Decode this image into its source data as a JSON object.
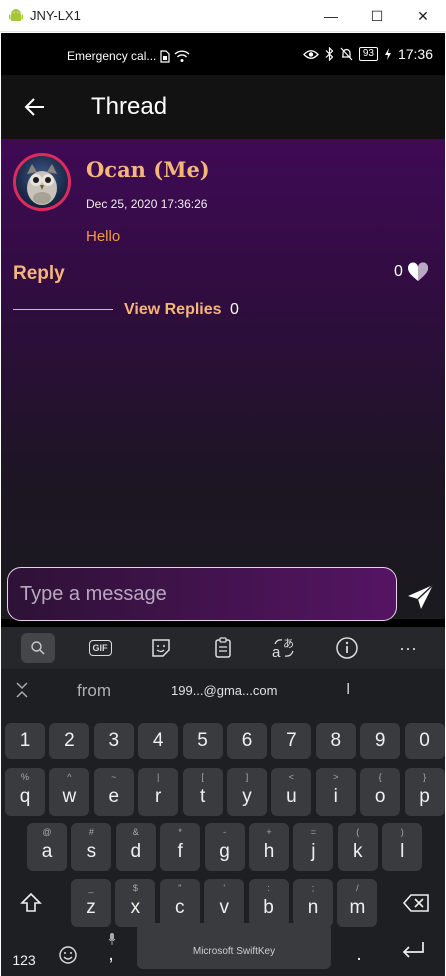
{
  "window": {
    "title": "JNY-LX1",
    "minimize_glyph": "—",
    "maximize_glyph": "☐",
    "close_glyph": "✕"
  },
  "status_bar": {
    "carrier": "Emergency cal...",
    "battery": "93",
    "time": "17:36",
    "icons": [
      "sim-icon",
      "wifi-icon",
      "eye-icon",
      "bluetooth-icon",
      "mute-icon",
      "battery-icon",
      "charging-icon"
    ]
  },
  "app_bar": {
    "title": "Thread",
    "back_icon": "arrow-left-icon"
  },
  "post": {
    "username": "Ocan (Me)",
    "timestamp": "Dec 25, 2020 17:36:26",
    "message": "Hello",
    "reply_label": "Reply",
    "like_count": "0",
    "view_replies_label": "View Replies",
    "replies_count": "0"
  },
  "composer": {
    "placeholder": "Type a message",
    "send_icon": "send-icon"
  },
  "keyboard": {
    "toolbar_icons": [
      "search-icon",
      "gif-icon",
      "sticker-icon",
      "clipboard-icon",
      "translate-icon",
      "info-icon",
      "more-icon"
    ],
    "gif_label": "GIF",
    "more_label": "···",
    "suggestions": [
      "from",
      "199...@gma...com",
      "I"
    ],
    "number_row": [
      "1",
      "2",
      "3",
      "4",
      "5",
      "6",
      "7",
      "8",
      "9",
      "0"
    ],
    "row1": [
      {
        "key": "q",
        "hint": "%"
      },
      {
        "key": "w",
        "hint": "^"
      },
      {
        "key": "e",
        "hint": "~"
      },
      {
        "key": "r",
        "hint": "|"
      },
      {
        "key": "t",
        "hint": "["
      },
      {
        "key": "y",
        "hint": "]"
      },
      {
        "key": "u",
        "hint": "<"
      },
      {
        "key": "i",
        "hint": ">"
      },
      {
        "key": "o",
        "hint": "{"
      },
      {
        "key": "p",
        "hint": "}"
      }
    ],
    "row2": [
      {
        "key": "a",
        "hint": "@"
      },
      {
        "key": "s",
        "hint": "#"
      },
      {
        "key": "d",
        "hint": "&"
      },
      {
        "key": "f",
        "hint": "*"
      },
      {
        "key": "g",
        "hint": "-"
      },
      {
        "key": "h",
        "hint": "+"
      },
      {
        "key": "j",
        "hint": "="
      },
      {
        "key": "k",
        "hint": "("
      },
      {
        "key": "l",
        "hint": ")"
      }
    ],
    "row3": [
      {
        "key": "z",
        "hint": "_"
      },
      {
        "key": "x",
        "hint": "$"
      },
      {
        "key": "c",
        "hint": "\""
      },
      {
        "key": "v",
        "hint": "'"
      },
      {
        "key": "b",
        "hint": ":"
      },
      {
        "key": "n",
        "hint": ";"
      },
      {
        "key": "m",
        "hint": "/"
      }
    ],
    "shift_icon": "shift-icon",
    "backspace_icon": "backspace-icon",
    "symbols_label": "123",
    "emoji_icon": "emoji-icon",
    "comma_label": ",",
    "space_label": "Microsoft SwiftKey",
    "period_label": ".",
    "enter_icon": "enter-icon"
  },
  "colors": {
    "accent": "#f6b57a",
    "message": "#f49c3c",
    "avatar_ring": "#e0295d",
    "gradient_top": "#3f0a55"
  }
}
